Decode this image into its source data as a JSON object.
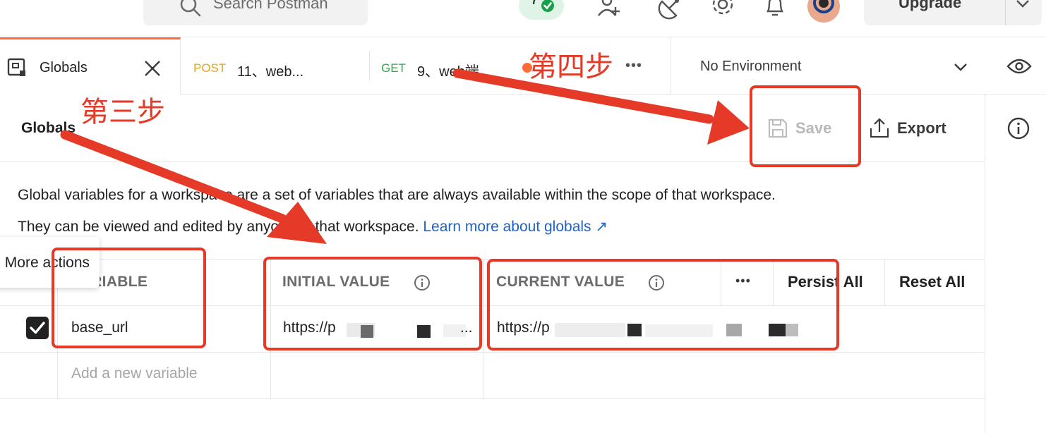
{
  "header": {
    "search_placeholder": "Search Postman",
    "upgrade_label": "Upgrade"
  },
  "tabs": [
    {
      "label": "Globals",
      "active": true
    },
    {
      "method": "POST",
      "label": "11、web..."
    },
    {
      "method": "GET",
      "label": "9、web端..."
    }
  ],
  "tab_more": "•••",
  "environment": {
    "selected": "No Environment"
  },
  "toolbar": {
    "title": "Globals",
    "save_label": "Save",
    "export_label": "Export"
  },
  "description": {
    "line1": "Global variables for a workspace are a set of variables that are always available within the scope of that workspace.",
    "line2": "They can be viewed and edited by anyone in that workspace.",
    "link": "Learn more about globals ↗"
  },
  "table": {
    "headers": {
      "variable": "VARIABLE",
      "initial": "INITIAL VALUE",
      "current": "CURRENT VALUE",
      "more": "•••"
    },
    "persist_all": "Persist All",
    "reset_all": "Reset All",
    "rows": [
      {
        "enabled": true,
        "variable": "base_url",
        "initial_value": "https://p",
        "initial_suffix": "...",
        "current_value": "https://p"
      }
    ],
    "add_placeholder": "Add a new variable"
  },
  "tooltip": "More actions",
  "annotations": {
    "step3": "第三步",
    "step4": "第四步"
  },
  "colors": {
    "accent": "#ff6c37",
    "annotation_red": "#e53a28",
    "link_blue": "#1d62c9",
    "post": "#e6a619",
    "get": "#2faa4a"
  }
}
